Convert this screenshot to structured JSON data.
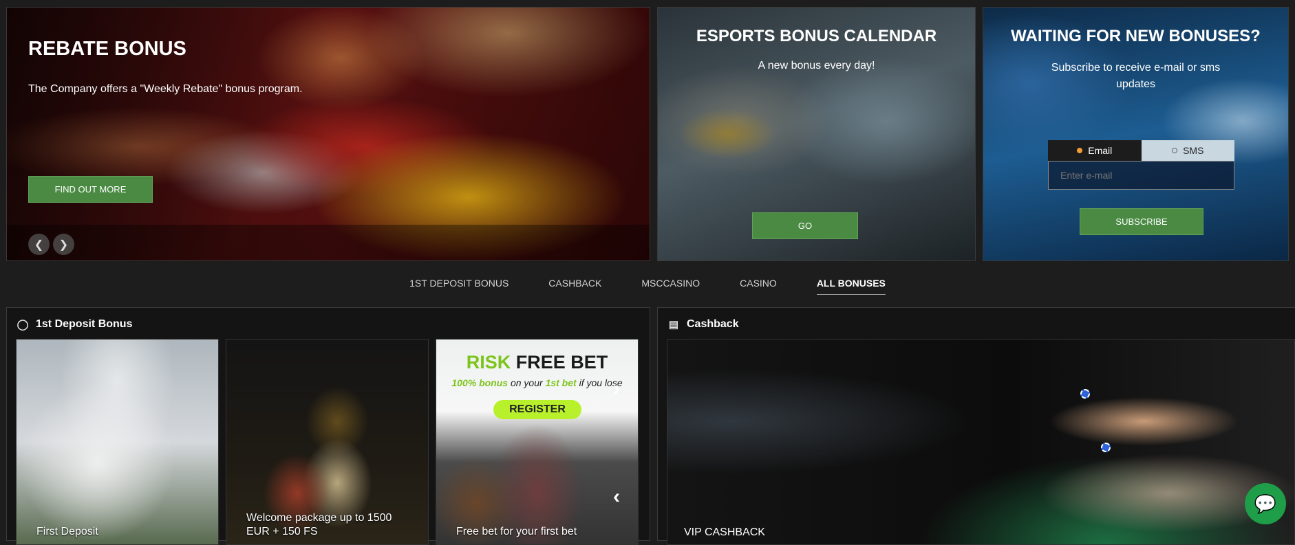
{
  "hero": {
    "title": "REBATE BONUS",
    "text": "The Company offers a \"Weekly Rebate\" bonus program.",
    "button": "FIND OUT MORE",
    "prev_icon": "chevron-left-icon",
    "next_icon": "chevron-right-icon"
  },
  "esports": {
    "title": "ESPORTS BONUS CALENDAR",
    "text": "A new bonus every day!",
    "button": "GO"
  },
  "subscribe": {
    "title": "WAITING FOR NEW BONUSES?",
    "text": "Subscribe to receive e-mail or sms updates",
    "option_email": "Email",
    "option_sms": "SMS",
    "selected": "Email",
    "input_placeholder": "Enter e-mail",
    "button": "SUBSCRIBE"
  },
  "tabs": [
    {
      "label": "1ST DEPOSIT BONUS"
    },
    {
      "label": "CASHBACK"
    },
    {
      "label": "MSCCASINO"
    },
    {
      "label": "CASINO"
    },
    {
      "label": "ALL BONUSES"
    }
  ],
  "active_tab": "ALL BONUSES",
  "deposit_section": {
    "title": "1st Deposit Bonus",
    "icon": "deposit-coin-icon",
    "tiles": [
      {
        "label": "First Deposit"
      },
      {
        "label": "Welcome package up to 1500 EUR + 150 FS"
      },
      {
        "label": "Free bet for your first bet",
        "banner_risk": "RISK",
        "banner_free": "FREE BET",
        "banner_bonus": "100% bonus",
        "banner_text_1": "on your",
        "banner_first": "1st bet",
        "banner_text_2": "if you lose",
        "banner_register": "REGISTER"
      }
    ]
  },
  "cashback_section": {
    "title": "Cashback",
    "icon": "wallet-icon",
    "tile_label": "VIP CASHBACK"
  },
  "chat_icon": "chat-bubble-icon",
  "colors": {
    "accent_green": "#4a8a43",
    "chat_green": "#1e9e48",
    "radio_active": "#f39c33",
    "background": "#1d1d1d"
  }
}
